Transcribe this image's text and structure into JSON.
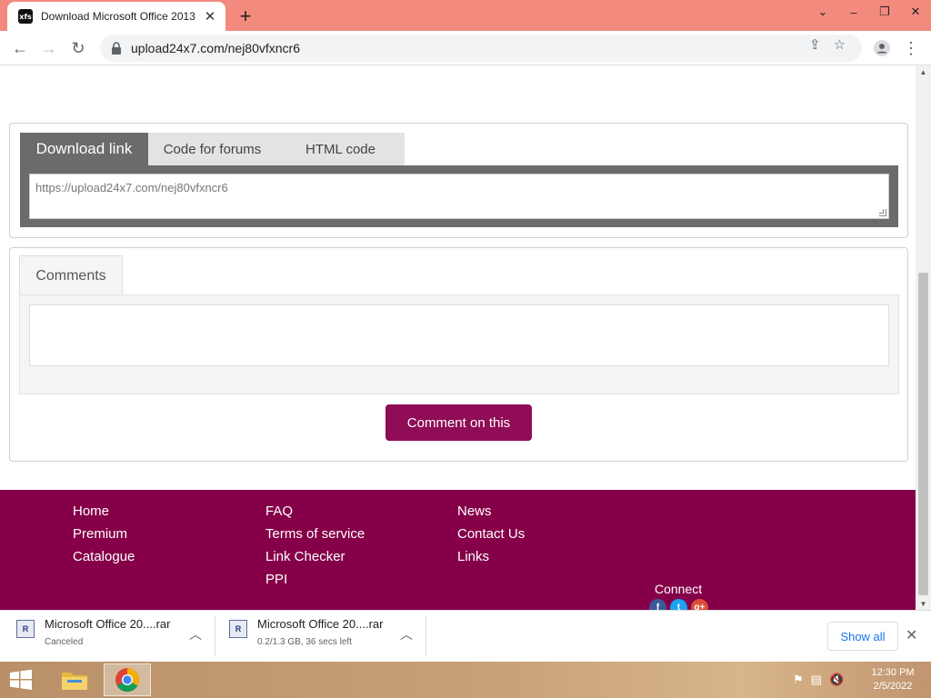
{
  "browser": {
    "tab_title": "Download Microsoft Office 2013",
    "favicon_text": "xfs",
    "url": "upload24x7.com/nej80vfxncr6"
  },
  "panel_link": {
    "tabs": [
      "Download link",
      "Code for forums",
      "HTML code"
    ],
    "link_value": "https://upload24x7.com/nej80vfxncr6"
  },
  "comments": {
    "tab_label": "Comments",
    "textarea_value": "",
    "button_label": "Comment on this"
  },
  "footer": {
    "col1": [
      "Home",
      "Premium",
      "Catalogue"
    ],
    "col2": [
      "FAQ",
      "Terms of service",
      "Link Checker",
      "PPI"
    ],
    "col3": [
      "News",
      "Contact Us",
      "Links"
    ],
    "connect_label": "Connect",
    "social_glyphs": [
      "f",
      "t",
      "g+"
    ]
  },
  "downloads": [
    {
      "name": "Microsoft Office 20....rar",
      "status": "Canceled"
    },
    {
      "name": "Microsoft Office 20....rar",
      "status": "0.2/1.3 GB, 36 secs left"
    }
  ],
  "shelf": {
    "show_all_label": "Show all"
  },
  "taskbar": {
    "time": "12:30 PM",
    "date": "2/5/2022"
  },
  "colors": {
    "accent": "#900c56",
    "footer": "#850048",
    "titlebar": "#f28b7e"
  }
}
